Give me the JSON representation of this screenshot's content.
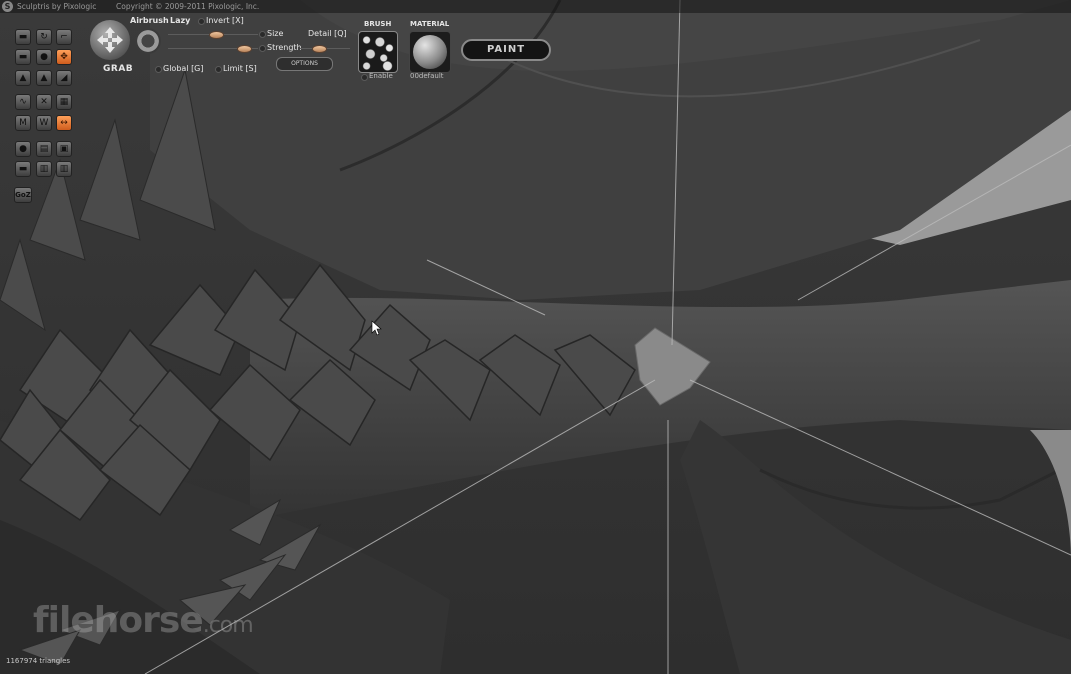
{
  "app": {
    "title": "Sculptris by Pixologic",
    "copyright": "Copyright © 2009-2011 Pixologic, Inc."
  },
  "toolbar": {
    "tool_name": "GRAB",
    "airbrush": "Airbrush",
    "lazy": "Lazy",
    "invert": "Invert [X]",
    "size": "Size",
    "strength": "Strength",
    "detail": "Detail [Q]",
    "global": "Global [G]",
    "limit": "Limit [S]",
    "options": "OPTIONS",
    "brush_label": "BRUSH",
    "brush_enable": "Enable",
    "material_label": "MATERIAL",
    "material_name": "00default",
    "paint": "PAINT"
  },
  "tools": [
    {
      "icon": "draw-icon",
      "glyph": "▬"
    },
    {
      "icon": "rotate-icon",
      "glyph": "↻"
    },
    {
      "icon": "crease-icon",
      "glyph": "⌐"
    },
    {
      "icon": "flatten-icon",
      "glyph": "▬"
    },
    {
      "icon": "inflate-icon",
      "glyph": "●"
    },
    {
      "icon": "grab-tool-icon",
      "glyph": "✥",
      "active": true
    },
    {
      "icon": "pinch-icon",
      "glyph": "▲"
    },
    {
      "icon": "smooth-icon",
      "glyph": "▲"
    },
    {
      "icon": "scale-icon",
      "glyph": "◢"
    },
    {
      "icon": "curve-icon",
      "glyph": "∿"
    },
    {
      "icon": "cross-icon",
      "glyph": "✕"
    },
    {
      "icon": "grid-icon",
      "glyph": "▦"
    },
    {
      "icon": "mirror-icon",
      "glyph": "M"
    },
    {
      "icon": "wave-icon",
      "glyph": "W"
    },
    {
      "icon": "symmetry-icon",
      "glyph": "↔",
      "active": true
    },
    {
      "icon": "sphere-icon",
      "glyph": "●"
    },
    {
      "icon": "open-icon",
      "glyph": "▤"
    },
    {
      "icon": "obj-icon",
      "glyph": "▣"
    },
    {
      "icon": "minus-icon",
      "glyph": "▬"
    },
    {
      "icon": "save-icon",
      "glyph": "▥"
    },
    {
      "icon": "export-icon",
      "glyph": "▥"
    }
  ],
  "goz": "GoZ",
  "watermark": {
    "brand": "filehorse",
    "tld": ".com"
  },
  "status": {
    "triangles": "1167974 triangles"
  }
}
